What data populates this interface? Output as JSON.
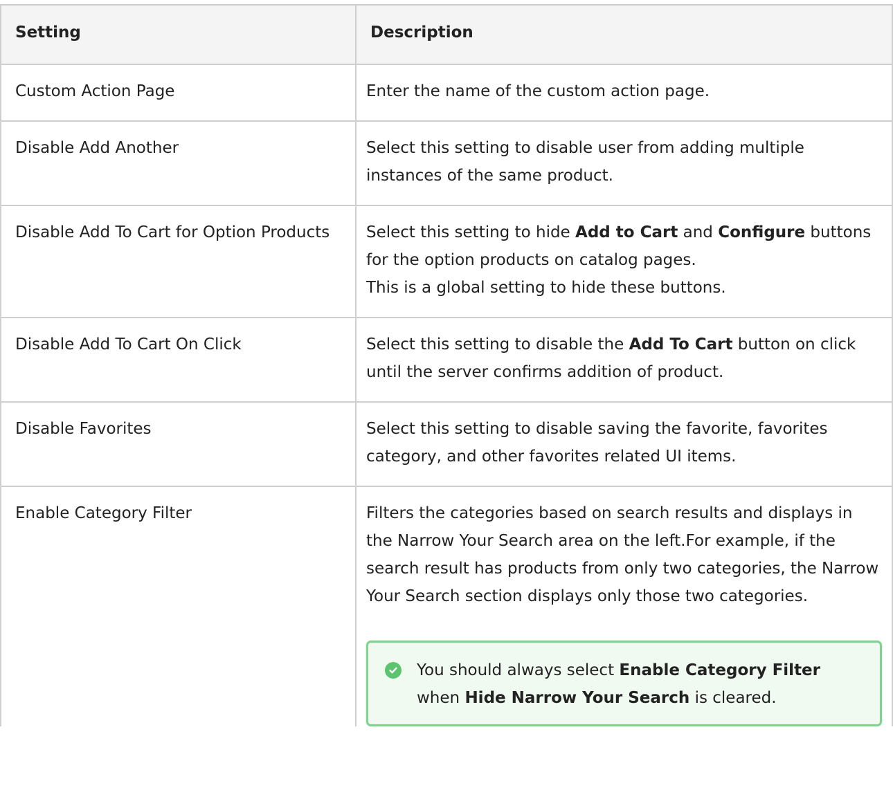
{
  "table": {
    "headers": [
      "Setting",
      "Description"
    ],
    "rows": [
      {
        "setting": "Custom Action Page",
        "description": "Enter the name of the custom action page."
      },
      {
        "setting": "Disable Add Another",
        "description": "Select this setting to disable user from adding multiple instances of the same product."
      },
      {
        "setting": "Disable Add To Cart for Option Products",
        "desc_part1": "Select this setting to hide ",
        "desc_bold1": "Add to Cart",
        "desc_part2": " and ",
        "desc_bold2": "Configure",
        "desc_part3": " buttons for the option products on catalog pages.",
        "desc_line2": "This is a global setting to hide these buttons."
      },
      {
        "setting": "Disable Add To Cart On Click",
        "desc_part1": "Select this setting to disable the ",
        "desc_bold1": "Add To Cart",
        "desc_part2": " button on click until the server confirms addition of product."
      },
      {
        "setting": "Disable Favorites",
        "description": "Select this setting to disable saving the favorite, favorites category, and other favorites related UI items."
      },
      {
        "setting": "Enable Category Filter",
        "description": "Filters the categories based on search results and displays in the Narrow Your Search area on the left.For example, if the search result has products from only two categories, the Narrow Your Search section displays only those two categories.",
        "tip": {
          "part1": "You should always select ",
          "bold1": "Enable Category Filter",
          "part2": " when ",
          "bold2": "Hide Narrow Your Search",
          "part3": " is cleared."
        }
      }
    ]
  },
  "icons": {
    "tip_icon": "check-circle-icon",
    "tip_color": "#5cc36e",
    "tip_border": "#7fd48f"
  }
}
